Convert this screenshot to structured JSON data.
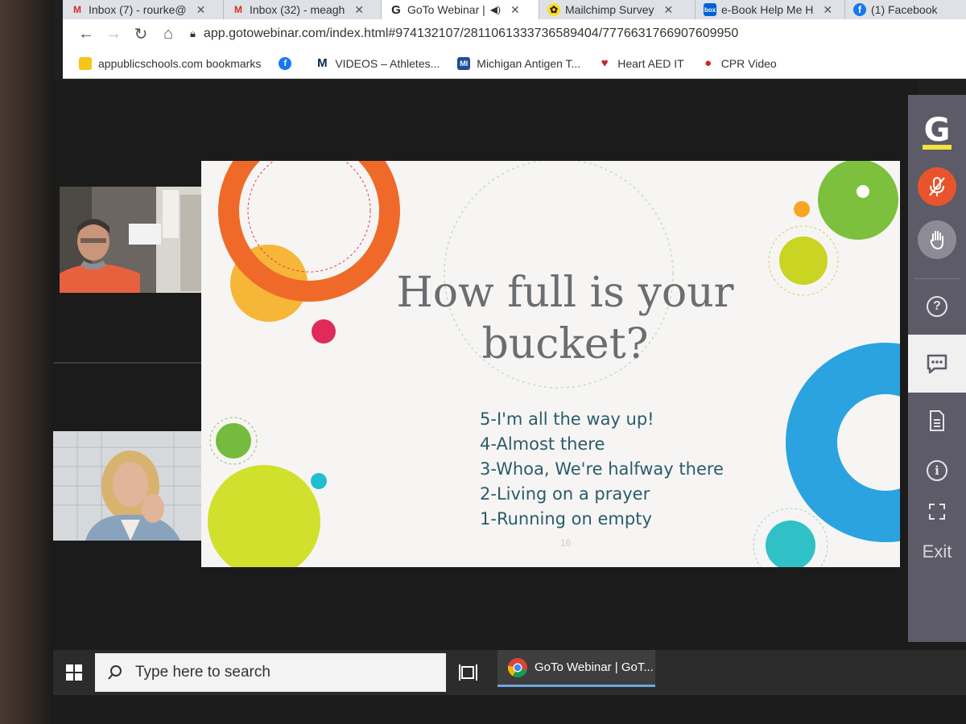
{
  "browser": {
    "tabs": [
      {
        "label": "Inbox (7) - rourke@",
        "icon": "gmail-icon",
        "active": false
      },
      {
        "label": "Inbox (32) - meagh",
        "icon": "gmail-icon",
        "active": false
      },
      {
        "label": "GoTo Webinar |",
        "icon": "goto-icon",
        "active": true,
        "icon_text": "G"
      },
      {
        "label": "Mailchimp Survey",
        "icon": "mailchimp-icon",
        "active": false
      },
      {
        "label": "e-Book Help Me H",
        "icon": "box-icon",
        "active": false,
        "icon_text": "box"
      },
      {
        "label": "(1) Facebook",
        "icon": "facebook-icon",
        "active": false
      }
    ],
    "url": "app.gotowebinar.com/index.html#974132107/2811061333736589404/7776631766907609950",
    "bookmarks": [
      {
        "label": "appublicschools.com bookmarks",
        "icon": "folder-icon"
      },
      {
        "label": "",
        "icon": "facebook-icon"
      },
      {
        "label": "VIDEOS – Athletes...",
        "icon": "michigan-icon",
        "icon_text": "M"
      },
      {
        "label": "Michigan Antigen T...",
        "icon": "mi-icon",
        "icon_text": "MI"
      },
      {
        "label": "Heart AED IT",
        "icon": "heart-icon"
      },
      {
        "label": "CPR Video",
        "icon": "apple-icon"
      }
    ]
  },
  "slide": {
    "title": "How full is your bucket?",
    "list": [
      "5-I'm all the way up!",
      "4-Almost there",
      "3-Whoa, We're halfway there",
      "2-Living on a prayer",
      "1-Running on empty"
    ],
    "page_number": "16"
  },
  "panel": {
    "logo": "G",
    "exit": "Exit",
    "colors": {
      "panel": "#5d5b67",
      "mute": "#e8552c",
      "accent": "#f4e241"
    }
  },
  "taskbar": {
    "search_placeholder": "Type here to search",
    "app_label": "GoTo Webinar | GoT..."
  }
}
